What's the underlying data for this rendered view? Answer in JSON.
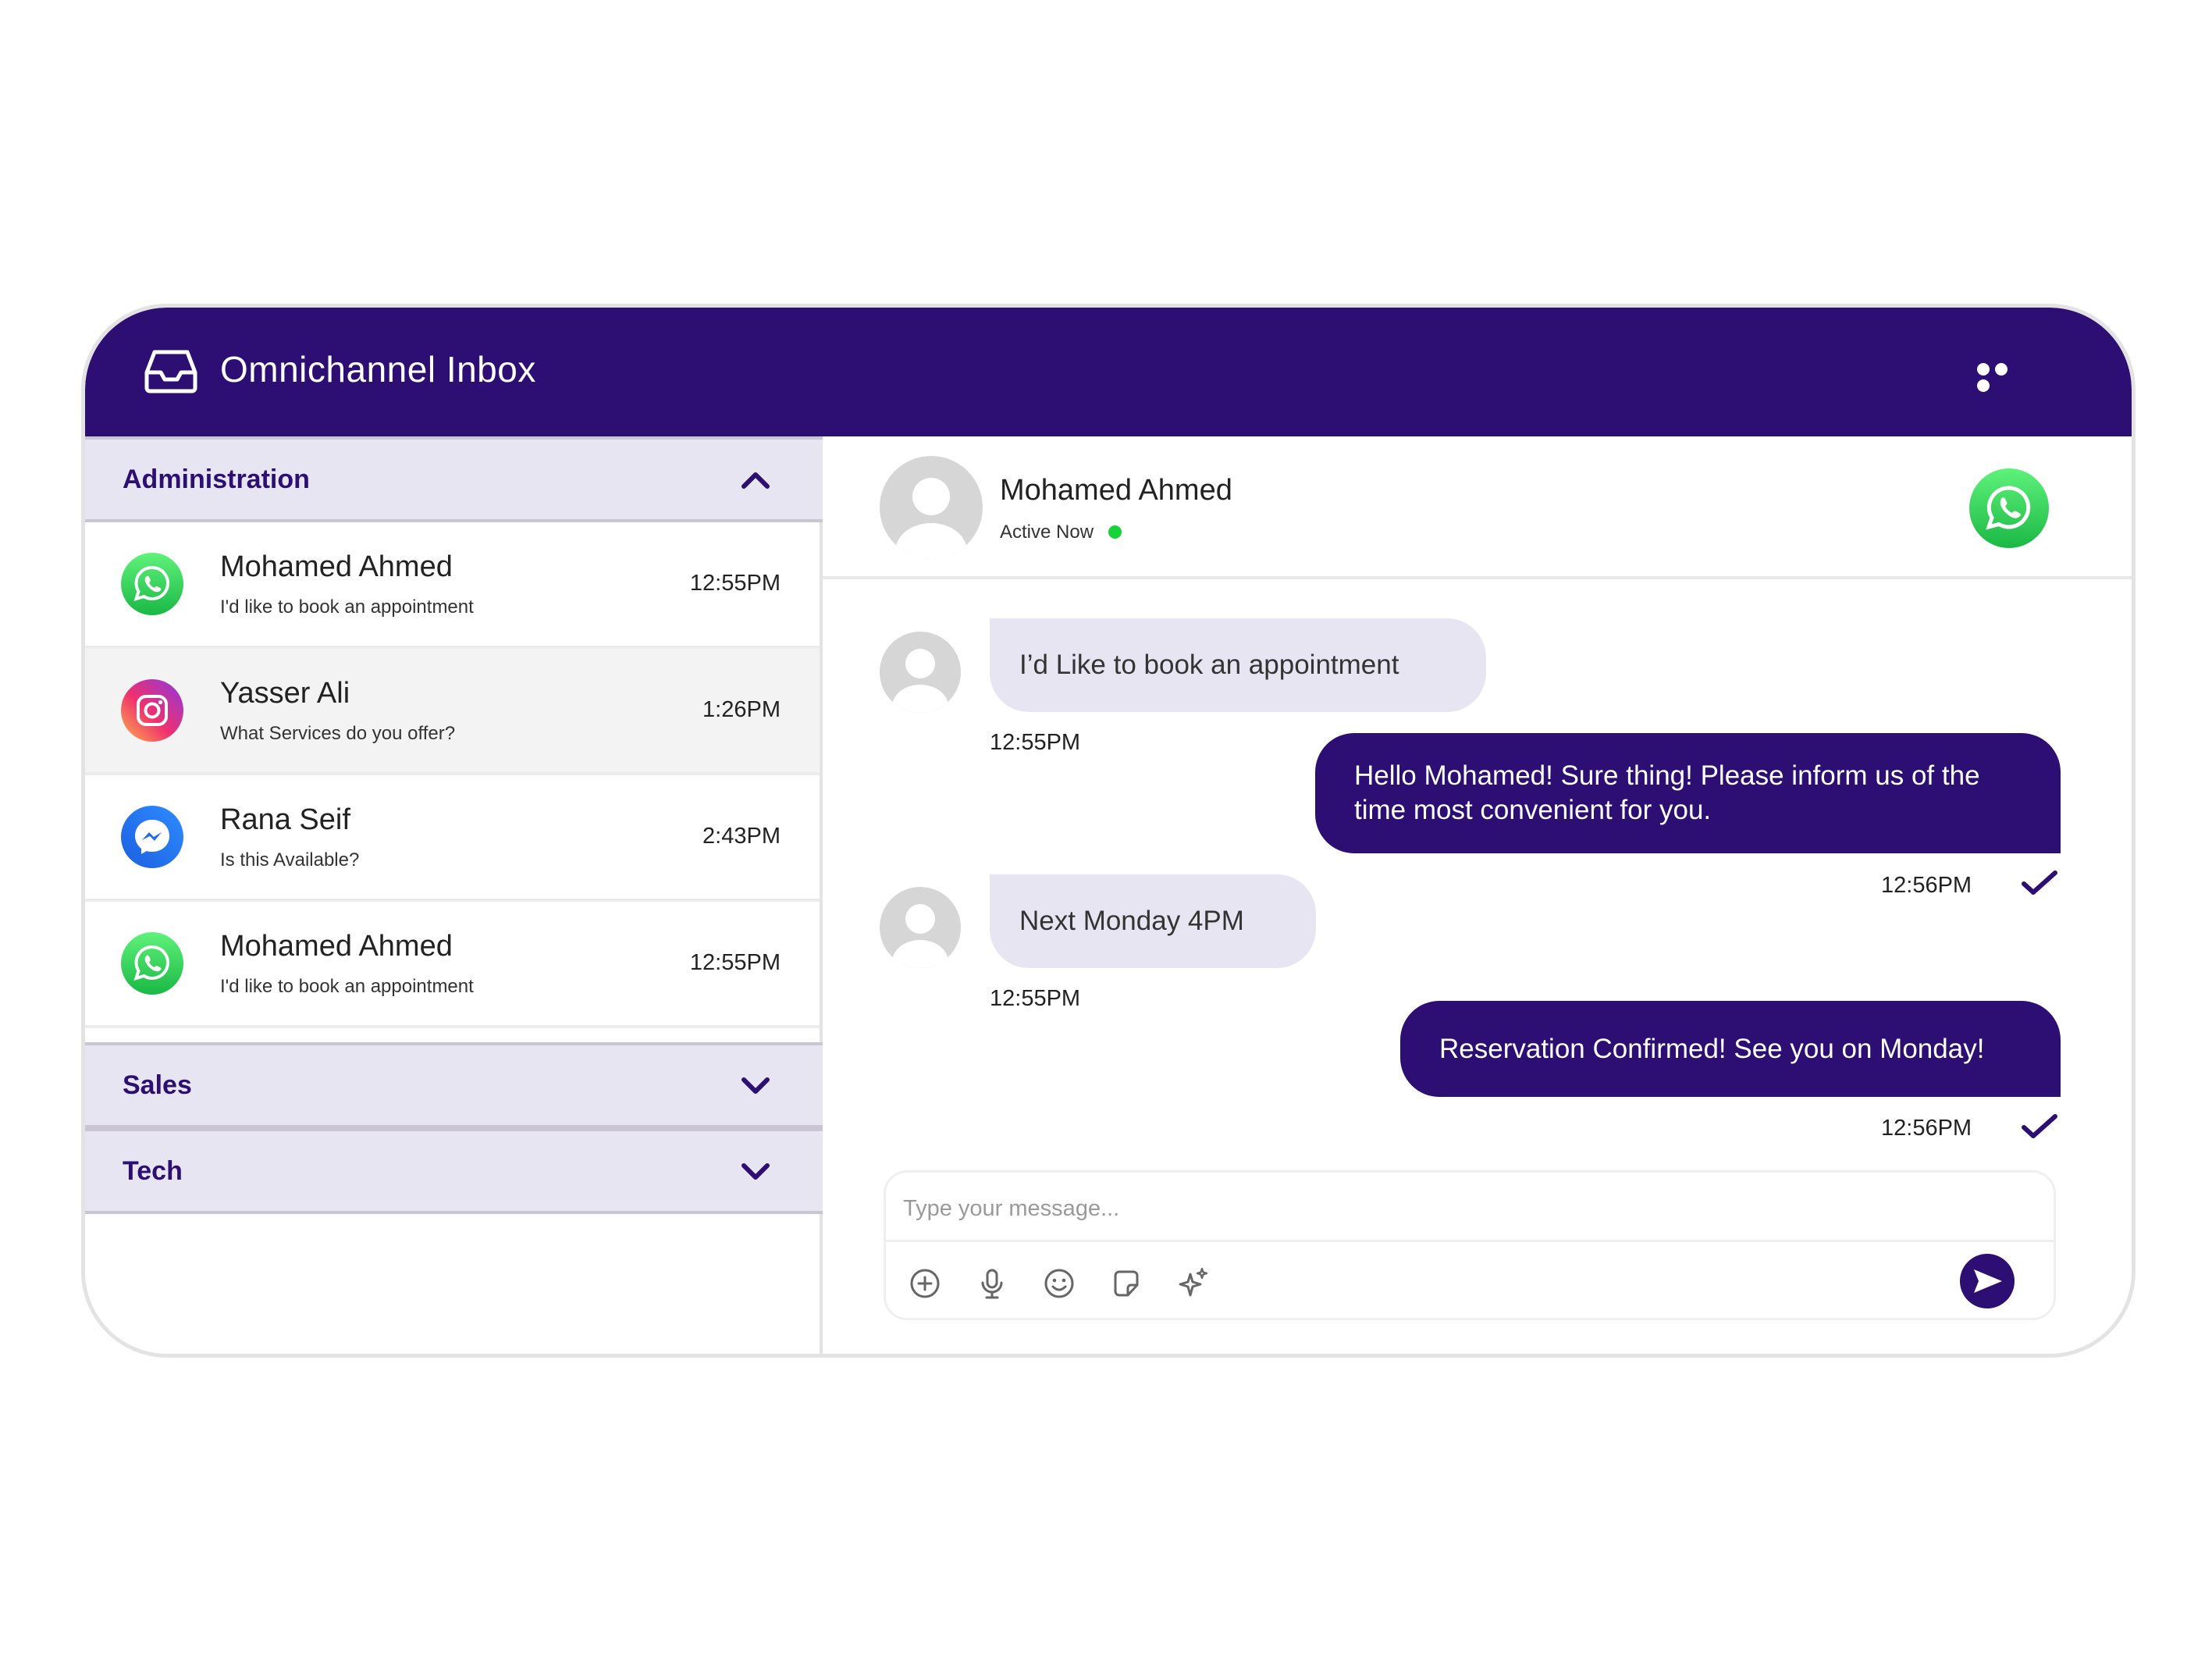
{
  "app": {
    "title": "Omnichannel Inbox",
    "brand_color": "#2d0f73"
  },
  "groups": [
    {
      "label": "Administration",
      "expanded": true,
      "conversations": [
        {
          "name": "Mohamed Ahmed",
          "preview": "I'd like to book an appointment",
          "time": "12:55PM",
          "channel": "whatsapp-icon"
        },
        {
          "name": "Yasser Ali",
          "preview": "What Services do you offer?",
          "time": "1:26PM",
          "channel": "instagram-icon"
        },
        {
          "name": "Rana Seif",
          "preview": "Is this Available?",
          "time": "2:43PM",
          "channel": "messenger-icon"
        },
        {
          "name": "Mohamed Ahmed",
          "preview": "I'd like to book an appointment",
          "time": "12:55PM",
          "channel": "whatsapp-icon"
        }
      ]
    },
    {
      "label": "Sales",
      "expanded": false
    },
    {
      "label": "Tech",
      "expanded": false
    }
  ],
  "chat": {
    "contact_name": "Mohamed Ahmed",
    "status": "Active Now",
    "channel": "whatsapp-icon",
    "messages": [
      {
        "direction": "in",
        "text": "I’d Like to book an appointment",
        "time": "12:55PM"
      },
      {
        "direction": "out",
        "text": "Hello Mohamed! Sure thing! Please inform us of the time most convenient for you.",
        "time": "12:56PM",
        "read": true
      },
      {
        "direction": "in",
        "text": "Next Monday 4PM",
        "time": "12:55PM"
      },
      {
        "direction": "out",
        "text": "Reservation Confirmed! See you on Monday!",
        "time": "12:56PM",
        "read": true
      }
    ]
  },
  "composer": {
    "placeholder": "Type your message...",
    "value": "",
    "tools": [
      "add-icon",
      "microphone-icon",
      "emoji-icon",
      "sticker-icon",
      "sparkle-icon"
    ]
  }
}
